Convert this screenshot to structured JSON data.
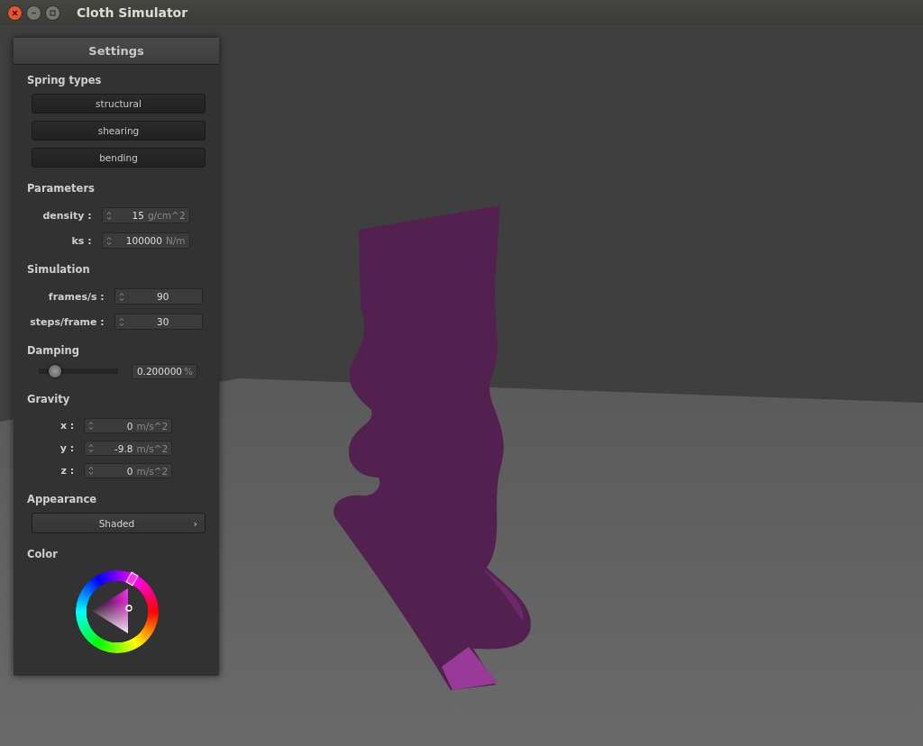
{
  "window": {
    "title": "Cloth Simulator"
  },
  "panel": {
    "title": "Settings",
    "sections": [
      {
        "kind": "buttons",
        "title": "Spring types",
        "buttons": [
          "structural",
          "shearing",
          "bending"
        ]
      },
      {
        "kind": "fields",
        "title": "Parameters",
        "fields": [
          {
            "label": "density :",
            "value": "15",
            "unit": "g/cm^2"
          },
          {
            "label": "ks :",
            "value": "100000",
            "unit": "N/m"
          }
        ]
      },
      {
        "kind": "fields",
        "title": "Simulation",
        "fields": [
          {
            "label": "frames/s :",
            "value": "90"
          },
          {
            "label": "steps/frame :",
            "value": "30"
          }
        ]
      },
      {
        "kind": "slider",
        "title": "Damping",
        "level": 0.2,
        "value": "0.200000",
        "unit": "%"
      },
      {
        "kind": "fields",
        "title": "Gravity",
        "fields": [
          {
            "label": "x :",
            "value": "0",
            "unit": "m/s^2"
          },
          {
            "label": "y :",
            "value": "-9.8",
            "unit": "m/s^2"
          },
          {
            "label": "z :",
            "value": "0",
            "unit": "m/s^2"
          }
        ]
      },
      {
        "kind": "dropdown",
        "title": "Appearance",
        "value": "Shaded",
        "arrow": "›"
      },
      {
        "kind": "color",
        "title": "Color",
        "color": "#ff33ee"
      }
    ]
  }
}
